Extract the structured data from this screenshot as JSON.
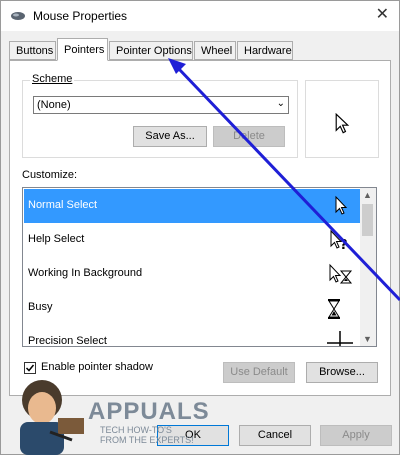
{
  "window": {
    "title": "Mouse Properties",
    "close_glyph": "✕"
  },
  "tabs": [
    {
      "label": "Buttons",
      "active": false
    },
    {
      "label": "Pointers",
      "active": true
    },
    {
      "label": "Pointer Options",
      "active": false
    },
    {
      "label": "Wheel",
      "active": false
    },
    {
      "label": "Hardware",
      "active": false
    }
  ],
  "scheme": {
    "label": "Scheme",
    "selected": "(None)",
    "save_as_label": "Save As...",
    "delete_label": "Delete"
  },
  "customize": {
    "label": "Customize:",
    "rows": [
      {
        "label": "Normal Select",
        "icon": "arrow-cursor-icon",
        "selected": true
      },
      {
        "label": "Help Select",
        "icon": "help-cursor-icon",
        "selected": false
      },
      {
        "label": "Working In Background",
        "icon": "working-cursor-icon",
        "selected": false
      },
      {
        "label": "Busy",
        "icon": "hourglass-icon",
        "selected": false
      },
      {
        "label": "Precision Select",
        "icon": "crosshair-icon",
        "selected": false
      }
    ]
  },
  "shadow": {
    "label": "Enable pointer shadow",
    "checked": true
  },
  "buttons": {
    "use_default": "Use Default",
    "browse": "Browse...",
    "ok": "OK",
    "cancel": "Cancel",
    "apply": "Apply"
  },
  "watermark": {
    "brand": "APPUALS",
    "tagline": "TECH HOW-TO'S FROM THE EXPERTS!"
  },
  "colors": {
    "selection": "#3399ff",
    "annotation_arrow": "#1f1fd6"
  }
}
